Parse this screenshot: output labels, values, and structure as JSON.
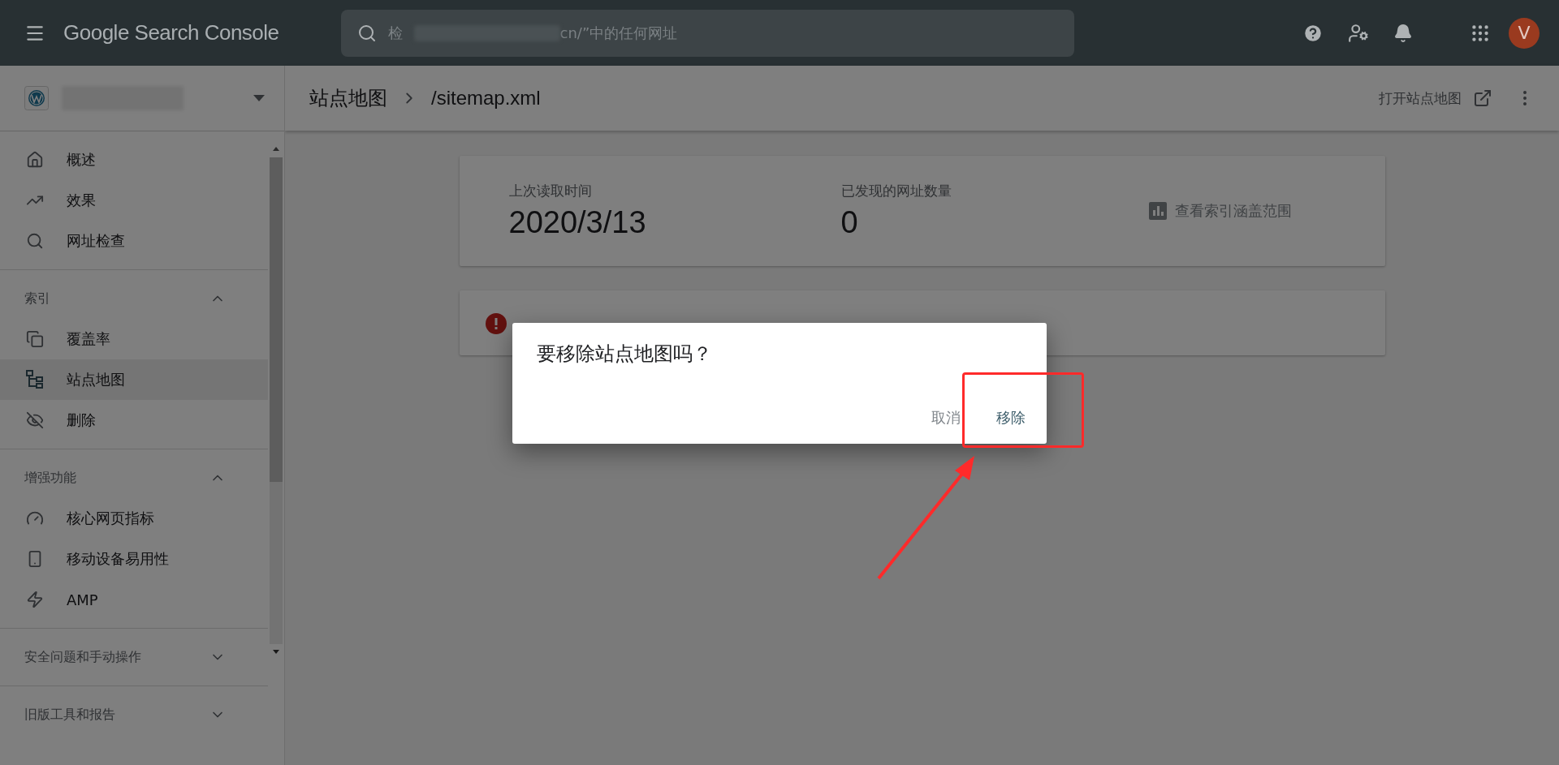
{
  "top_bar": {
    "product": "Google Search Console",
    "search": {
      "prefix": "检",
      "suffix": "cn/”中的任何网址"
    },
    "avatar": "V"
  },
  "sidebar": {
    "items": [
      {
        "label": "概述",
        "selected": false
      },
      {
        "label": "效果",
        "selected": false
      },
      {
        "label": "网址检查",
        "selected": false
      }
    ],
    "sections": [
      {
        "title": "索引",
        "expanded": true,
        "items": [
          {
            "label": "覆盖率",
            "selected": false
          },
          {
            "label": "站点地图",
            "selected": true
          },
          {
            "label": "删除",
            "selected": false
          }
        ]
      },
      {
        "title": "增强功能",
        "expanded": true,
        "items": [
          {
            "label": "核心网页指标",
            "selected": false
          },
          {
            "label": "移动设备易用性",
            "selected": false
          },
          {
            "label": "AMP",
            "selected": false
          }
        ]
      },
      {
        "title": "安全问题和手动操作",
        "expanded": false
      },
      {
        "title": "旧版工具和报告",
        "expanded": false
      }
    ]
  },
  "header": {
    "breadcrumb": [
      "站点地图",
      "/sitemap.xml"
    ],
    "action": "打开站点地图"
  },
  "summary_card": {
    "stats": [
      {
        "label": "上次读取时间",
        "value": "2020/3/13"
      },
      {
        "label": "已发现的网址数量",
        "value": "0"
      }
    ],
    "link": "查看索引涵盖范围"
  },
  "dialog": {
    "title": "要移除站点地图吗？",
    "buttons": [
      {
        "label": "取消",
        "kind": "cancel"
      },
      {
        "label": "移除",
        "kind": "confirm"
      }
    ]
  }
}
